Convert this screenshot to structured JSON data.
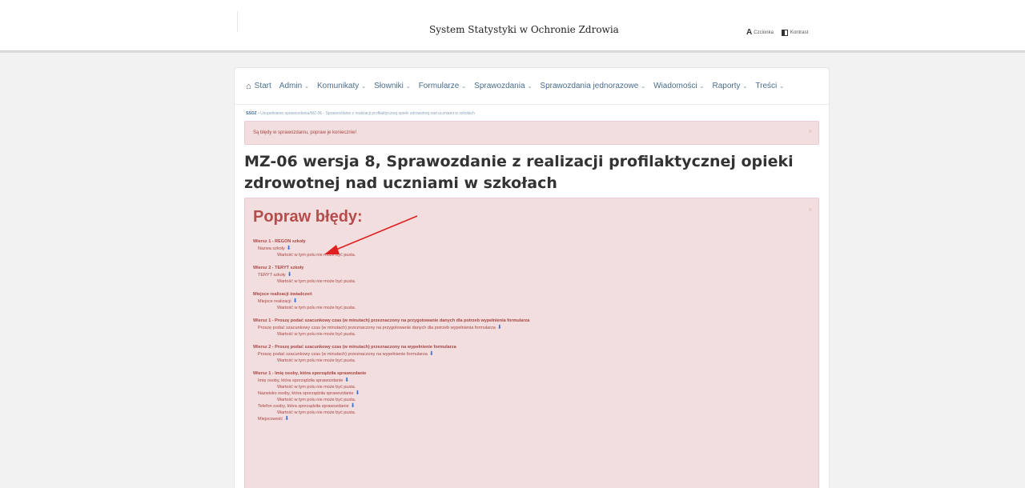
{
  "header": {
    "title": "System Statystyki w Ochronie Zdrowia",
    "accessibility": [
      {
        "icon": "font-size-icon",
        "label": "Czcionka"
      },
      {
        "icon": "contrast-icon",
        "label": "Kontrast"
      }
    ]
  },
  "nav": {
    "items": [
      {
        "label": "Start",
        "has_caret": false
      },
      {
        "label": "Admin",
        "has_caret": true
      },
      {
        "label": "Komunikaty",
        "has_caret": true
      },
      {
        "label": "Słowniki",
        "has_caret": true
      },
      {
        "label": "Formularze",
        "has_caret": true
      },
      {
        "label": "Sprawozdania",
        "has_caret": true
      },
      {
        "label": "Sprawozdania jednorazowe",
        "has_caret": true
      },
      {
        "label": "Wiadomości",
        "has_caret": true
      },
      {
        "label": "Raporty",
        "has_caret": true
      },
      {
        "label": "Treści",
        "has_caret": true
      }
    ],
    "caret": "⌄"
  },
  "breadcrumb": {
    "root": "SSOZ",
    "separator": "•",
    "path": "Uzupełnianie sprawozdania/MZ-06 - Sprawozdanie z realizacji profilaktycznej opieki zdrowotnej nad uczniami w szkołach"
  },
  "alert": {
    "message": "Są błędy w sprawozdaniu, popraw je koniecznie!",
    "close": "×"
  },
  "page": {
    "title": "MZ-06 wersja 8, Sprawozdanie z realizacji profilaktycznej opieki zdrowotnej nad uczniami w szkołach"
  },
  "errors": {
    "heading": "Popraw błędy:",
    "close": "×",
    "empty_msg": "Wartość w tym polu nie może być pusta.",
    "groups": [
      {
        "title": "Wiersz 1 - REGON szkoły",
        "fields": [
          {
            "label": "Nazwa szkoły",
            "msg": "Wartość w tym polu nie może być pusta."
          }
        ]
      },
      {
        "title": "Wiersz 2 - TERYT szkoły",
        "fields": [
          {
            "label": "TERYT szkoły",
            "msg": "Wartość w tym polu nie może być pusta."
          }
        ]
      },
      {
        "title": "Miejsce realizacji świadczeń",
        "fields": [
          {
            "label": "Miejsce realizacji",
            "msg": "Wartość w tym polu nie może być pusta."
          }
        ]
      },
      {
        "title": "Wiersz 1 - Proszę podać szacunkowy czas (w minutach) przeznaczony na przygotowanie danych dla potrzeb wypełnienia formularza",
        "fields": [
          {
            "label": "Proszę podać szacunkowy czas (w minutach) przeznaczony na przygotowanie danych dla potrzeb wypełnienia formularza",
            "msg": "Wartość w tym polu nie może być pusta."
          }
        ]
      },
      {
        "title": "Wiersz 2 - Proszę podać szacunkowy czas (w minutach) przeznaczony na wypełnienie formularza",
        "fields": [
          {
            "label": "Proszę podać szacunkowy czas (w minutach) przeznaczony na wypełnienie formularza",
            "msg": "Wartość w tym polu nie może być pusta."
          }
        ]
      },
      {
        "title": "Wiersz 1 - Imię osoby, która sporządziła sprawozdanie",
        "fields": [
          {
            "label": "Imię osoby, która sporządziła sprawozdanie",
            "msg": "Wartość w tym polu nie może być pusta."
          },
          {
            "label": "Nazwisko osoby, która sporządziła sprawozdanie",
            "msg": "Wartość w tym polu nie może być pusta."
          },
          {
            "label": "Telefon osoby, która sporządziła sprawozdanie",
            "msg": "Wartość w tym polu nie może być pusta."
          },
          {
            "label": "Miejscowość",
            "msg": ""
          }
        ]
      }
    ]
  },
  "colors": {
    "alert_bg": "#f2dede",
    "alert_text": "#a94442",
    "link": "#4a6e8f",
    "annotation_arrow": "#e02020"
  }
}
